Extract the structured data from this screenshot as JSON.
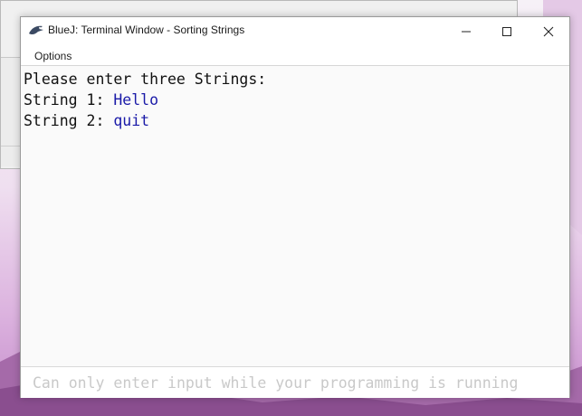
{
  "window": {
    "title": "BlueJ: Terminal Window - Sorting Strings",
    "controls": {
      "minimize_icon": "minimize-icon",
      "maximize_icon": "maximize-icon",
      "close_icon": "close-icon"
    }
  },
  "menu": {
    "options_label": "Options"
  },
  "terminal": {
    "prompt_line": "Please enter three Strings:",
    "entries": [
      {
        "label": "String 1: ",
        "value": "Hello"
      },
      {
        "label": "String 2: ",
        "value": "quit"
      }
    ]
  },
  "input": {
    "placeholder": "Can only enter input while your programming is running"
  },
  "colors": {
    "user_input": "#1a1aa8",
    "placeholder": "#c9c9c9",
    "terminal_bg": "#fafafa"
  }
}
